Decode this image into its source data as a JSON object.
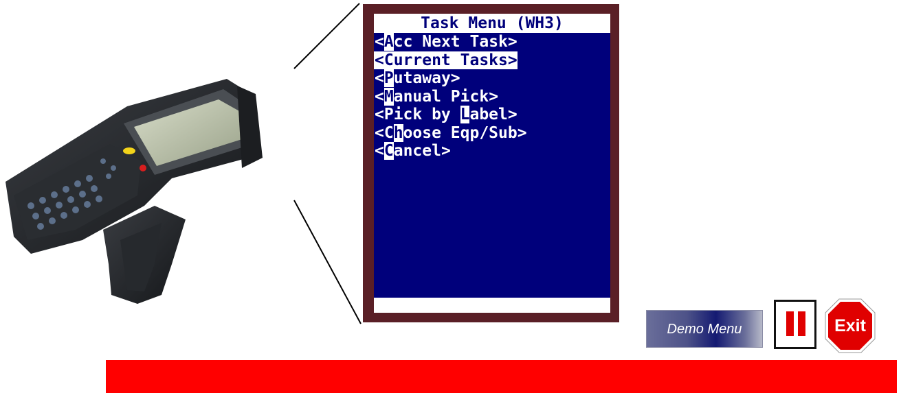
{
  "terminal": {
    "title": "Task Menu (WH3)",
    "menu_items": [
      {
        "pre": "<",
        "hot": "A",
        "post": "cc Next Task>",
        "selected": false
      },
      {
        "pre": "<Current Tasks>",
        "hot": "",
        "post": "",
        "selected": true
      },
      {
        "pre": "<",
        "hot": "P",
        "post": "utaway>",
        "selected": false
      },
      {
        "pre": "<",
        "hot": "M",
        "post": "anual Pick>",
        "selected": false
      },
      {
        "pre": "<Pick by ",
        "hot": "L",
        "post": "abel>",
        "selected": false
      },
      {
        "pre": "<C",
        "hot": "h",
        "post": "oose Eqp/Sub>",
        "selected": false
      },
      {
        "pre": "<",
        "hot": "C",
        "post": "ancel>",
        "selected": false
      }
    ],
    "colors": {
      "screen": "#00007b",
      "frame": "#5a1f26",
      "text": "#ffffff"
    }
  },
  "controls": {
    "demo_menu_label": "Demo Menu",
    "exit_label": "Exit",
    "pause_icon": "pause-icon"
  },
  "colors": {
    "footer_bar": "#ff0000",
    "exit_red": "#e00000"
  }
}
